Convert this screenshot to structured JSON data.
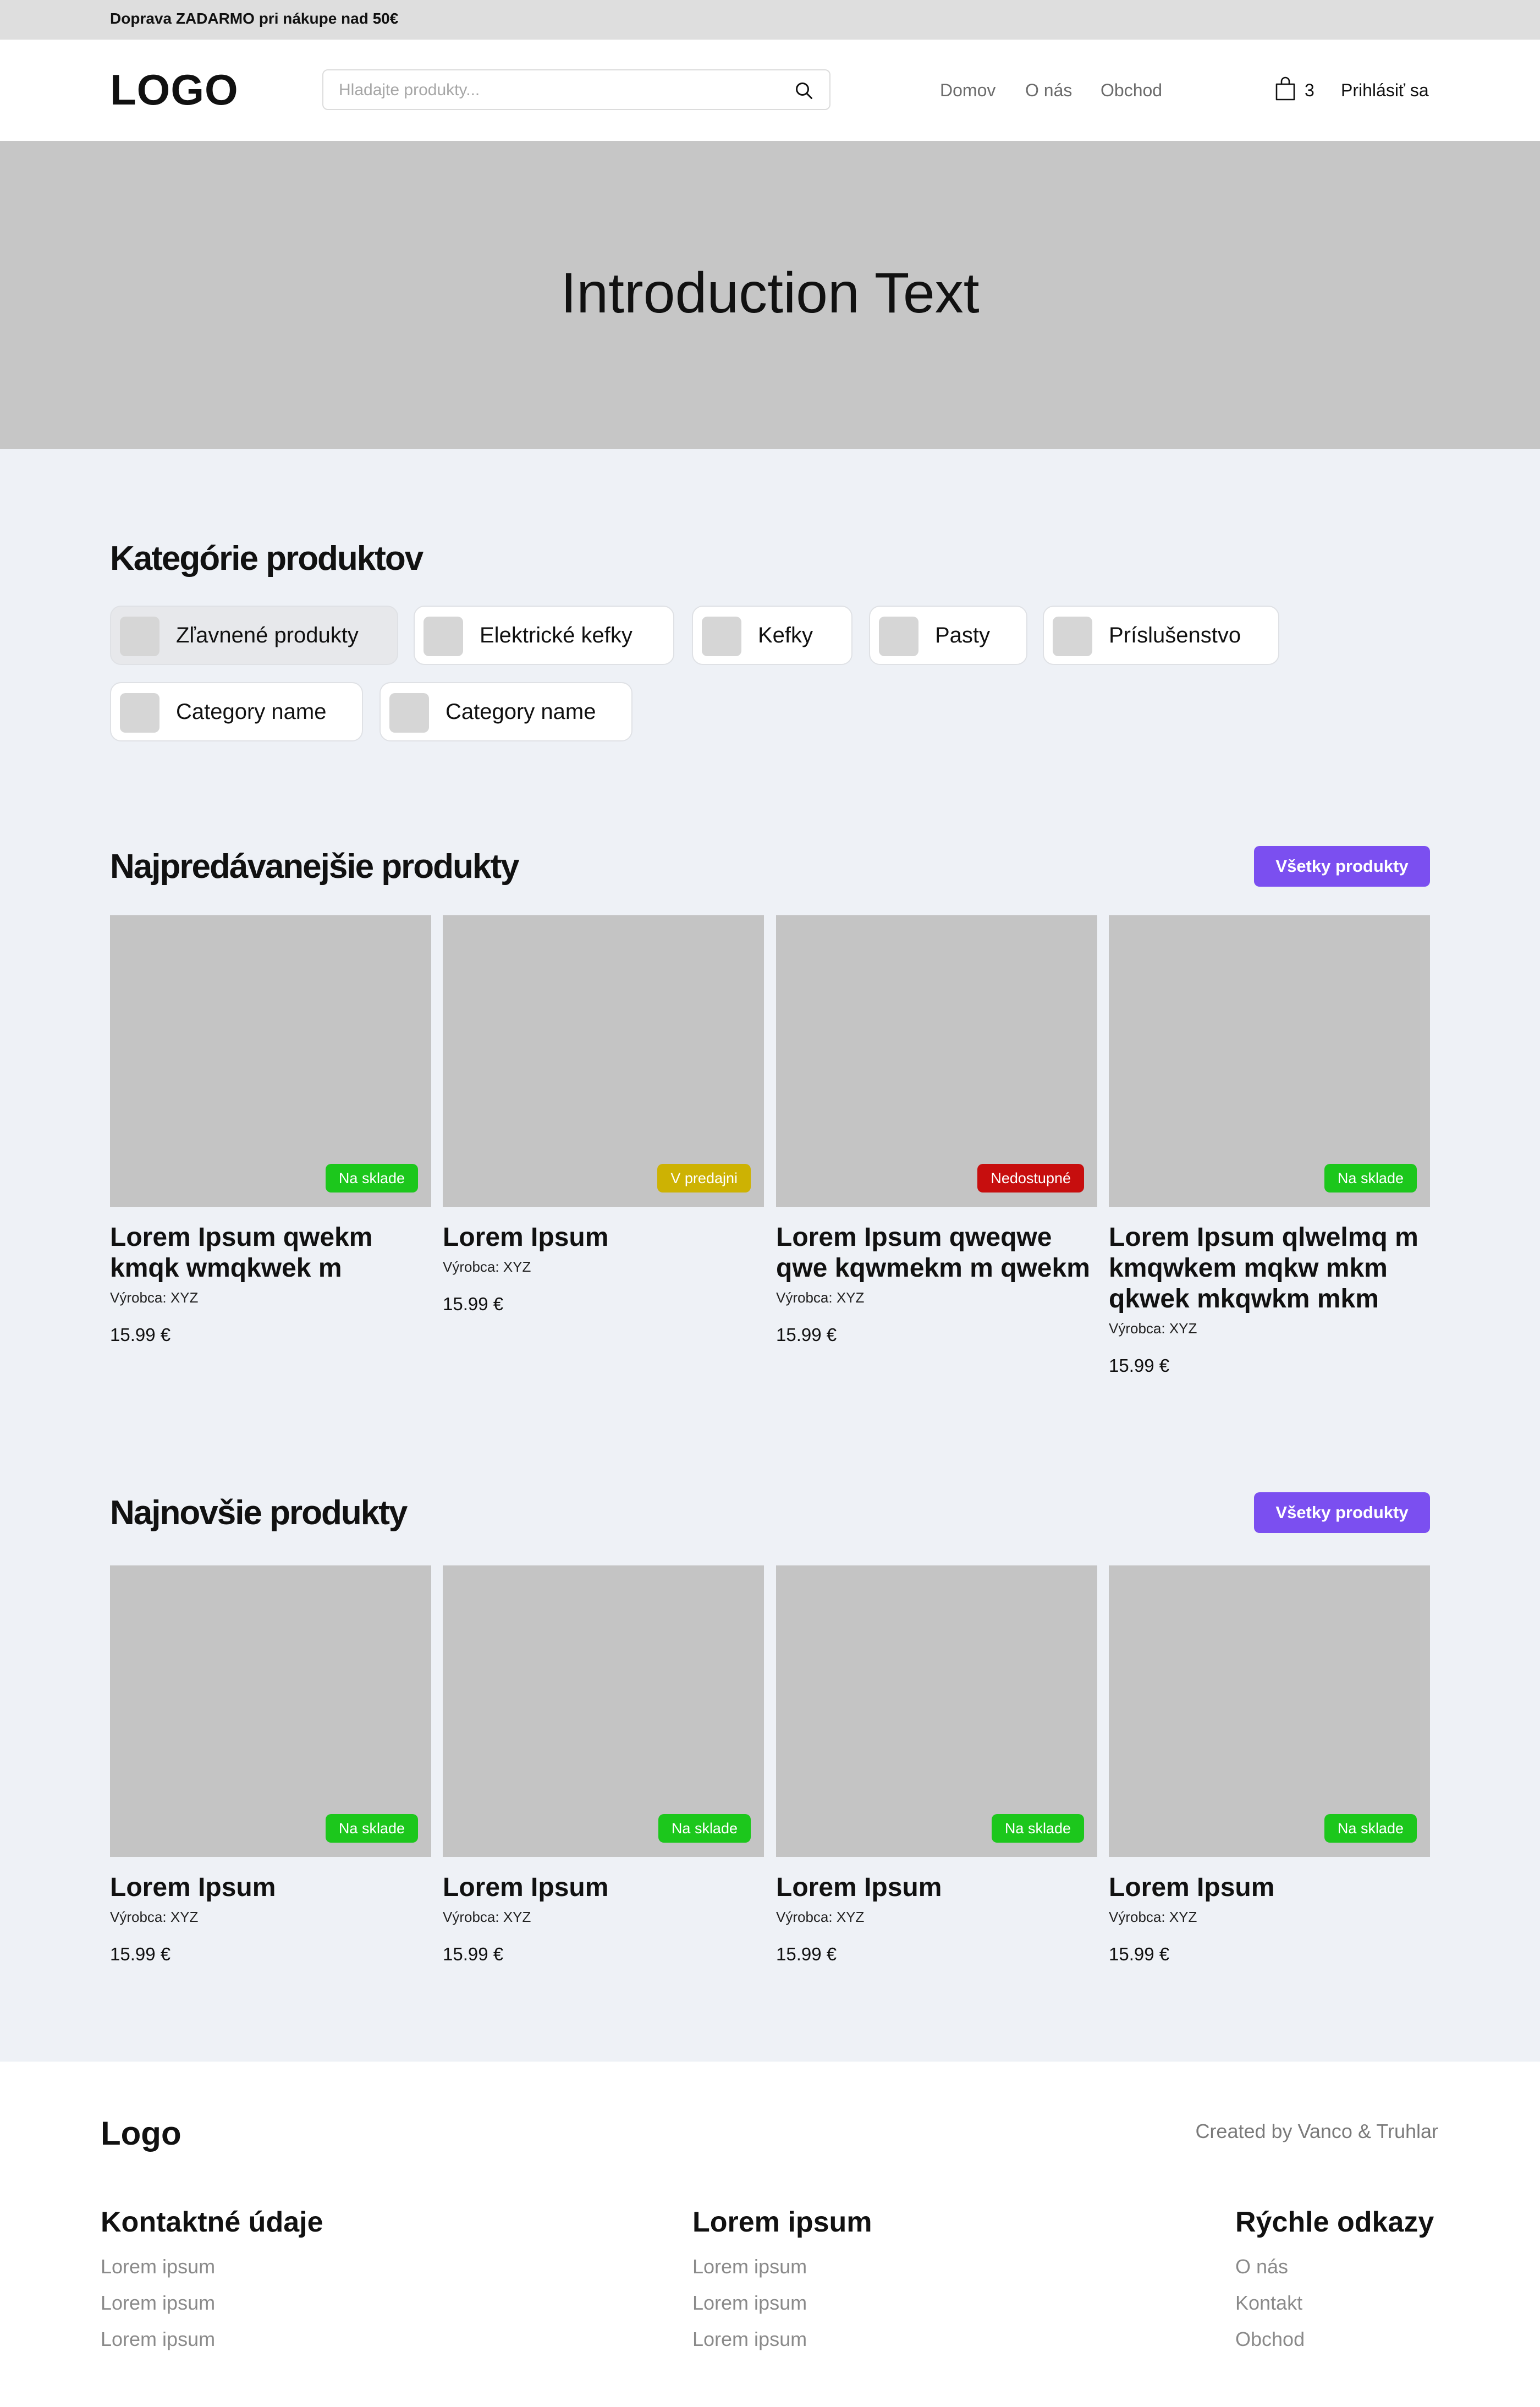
{
  "promo_bar": {
    "text": "Doprava ZADARMO pri  nákupe nad 50€"
  },
  "header": {
    "logo": "LOGO",
    "search": {
      "placeholder": "Hladajte produkty...",
      "value": "",
      "icon": "search-icon"
    },
    "nav": [
      "Domov",
      "O nás",
      "Obchod"
    ],
    "cart": {
      "icon": "shopping-bag-icon",
      "count": "3"
    },
    "login_label": "Prihlásiť sa"
  },
  "hero": {
    "title": "Introduction Text"
  },
  "categories": {
    "title": "Kategórie produktov",
    "items": [
      {
        "label": "Zľavnené produkty",
        "active": true
      },
      {
        "label": "Elektrické kefky",
        "active": false
      },
      {
        "label": "Kefky",
        "active": false
      },
      {
        "label": "Pasty",
        "active": false
      },
      {
        "label": "Príslušenstvo",
        "active": false
      },
      {
        "label": "Category name",
        "active": false
      },
      {
        "label": "Category name",
        "active": false
      }
    ]
  },
  "bestsellers": {
    "title": "Najpredávanejšie produkty",
    "button_label": "Všetky produkty",
    "products": [
      {
        "title": "Lorem Ipsum qwekm kmqk wmqkwek m",
        "maker": "Výrobca: XYZ",
        "price": "15.99 €",
        "badge": "Na sklade",
        "badge_color": "#1cc71c"
      },
      {
        "title": "Lorem Ipsum",
        "maker": "Výrobca: XYZ",
        "price": "15.99 €",
        "badge": "V predajni",
        "badge_color": "#cdb203"
      },
      {
        "title": "Lorem Ipsum qweqwe qwe kqwmekm m qwekm",
        "maker": "Výrobca: XYZ",
        "price": "15.99 €",
        "badge": "Nedostupné",
        "badge_color": "#c70e0e"
      },
      {
        "title": "Lorem Ipsum qlwelmq m kmqwkem mqkw mkm qkwek mkqwkm mkm",
        "maker": "Výrobca: XYZ",
        "price": "15.99 €",
        "badge": "Na sklade",
        "badge_color": "#1cc71c"
      }
    ]
  },
  "newest": {
    "title": "Najnovšie produkty",
    "button_label": "Všetky produkty",
    "products": [
      {
        "title": "Lorem Ipsum",
        "maker": "Výrobca: XYZ",
        "price": "15.99 €",
        "badge": "Na sklade",
        "badge_color": "#1cc71c"
      },
      {
        "title": "Lorem Ipsum",
        "maker": "Výrobca: XYZ",
        "price": "15.99 €",
        "badge": "Na sklade",
        "badge_color": "#1cc71c"
      },
      {
        "title": "Lorem Ipsum",
        "maker": "Výrobca: XYZ",
        "price": "15.99 €",
        "badge": "Na sklade",
        "badge_color": "#1cc71c"
      },
      {
        "title": "Lorem Ipsum",
        "maker": "Výrobca: XYZ",
        "price": "15.99 €",
        "badge": "Na sklade",
        "badge_color": "#1cc71c"
      }
    ]
  },
  "footer": {
    "logo": "Logo",
    "credit": "Created by Vanco & Truhlar",
    "columns": [
      {
        "title": "Kontaktné údaje",
        "links": [
          "Lorem ipsum",
          "Lorem ipsum",
          "Lorem ipsum"
        ]
      },
      {
        "title": "Lorem ipsum",
        "links": [
          "Lorem ipsum",
          "Lorem ipsum",
          "Lorem ipsum"
        ]
      },
      {
        "title": "Rýchle odkazy",
        "links": [
          "O nás",
          "Kontakt",
          "Obchod"
        ]
      }
    ]
  }
}
